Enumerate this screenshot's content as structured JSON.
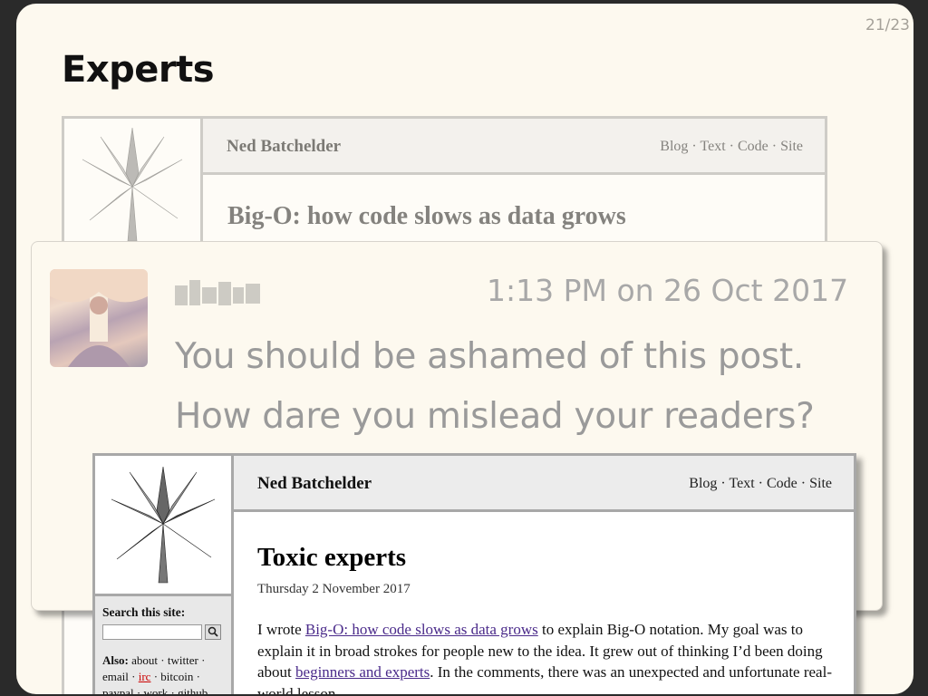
{
  "slide": {
    "counter": "21/23",
    "title": "Experts"
  },
  "back_blog": {
    "site_name": "Ned Batchelder",
    "nav": [
      "Blog",
      "Text",
      "Code",
      "Site"
    ],
    "nav_sep": " · ",
    "post_title": "Big-O: how code slows as data grows"
  },
  "comment": {
    "timestamp": "1:13 PM on 26 Oct 2017",
    "line1": "You should be ashamed of this post.",
    "line2": "How dare you mislead your readers?"
  },
  "front_blog": {
    "site_name": "Ned Batchelder",
    "nav": [
      "Blog",
      "Text",
      "Code",
      "Site"
    ],
    "search_label": "Search this site:",
    "also_label": "Also:",
    "also_links": [
      "about",
      "twitter",
      "email",
      "irc",
      "bitcoin",
      "paypal",
      "work",
      "github"
    ],
    "post_title": "Toxic experts",
    "post_date": "Thursday 2 November 2017",
    "body": {
      "p1": "I wrote ",
      "link1": "Big-O: how code slows as data grows",
      "p2": " to explain Big-O notation. My goal was to explain it in broad strokes for people new to the idea. It grew out of thinking I’d been doing about ",
      "link2": "beginners and experts",
      "p3": ". In the comments, there was an unexpected and unfortunate real-world lesson."
    }
  },
  "colors": {
    "slide_bg": "#fdf9ef",
    "link": "#4a2a8a",
    "irc_link": "#cc0000"
  }
}
